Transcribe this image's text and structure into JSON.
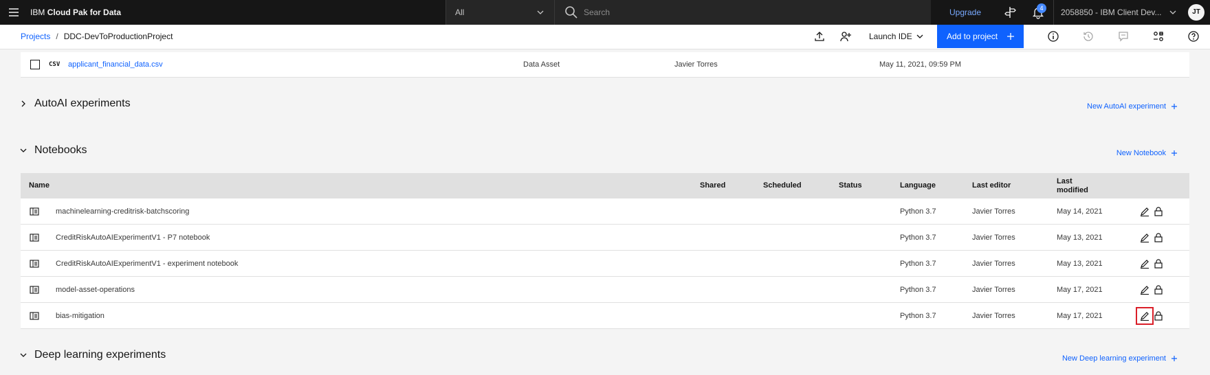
{
  "topnav": {
    "brand_prefix": "IBM",
    "brand_bold": "Cloud Pak for Data",
    "scope_value": "All",
    "search_placeholder": "Search",
    "upgrade_label": "Upgrade",
    "notification_count": "4",
    "account_name": "2058850 - IBM Client Dev...",
    "avatar_initials": "JT"
  },
  "subheader": {
    "breadcrumb_root": "Projects",
    "breadcrumb_separator": "/",
    "breadcrumb_current": "DDC-DevToProductionProject",
    "launch_ide_label": "Launch IDE",
    "add_to_project_label": "Add to project"
  },
  "data_asset": {
    "format": "CSV",
    "name": "applicant_financial_data.csv",
    "type": "Data Asset",
    "owner": "Javier Torres",
    "modified": "May 11, 2021, 09:59 PM"
  },
  "autoai": {
    "title": "AutoAI experiments",
    "new_label": "New AutoAI experiment"
  },
  "notebooks": {
    "title": "Notebooks",
    "new_label": "New Notebook",
    "columns": {
      "name": "Name",
      "shared": "Shared",
      "scheduled": "Scheduled",
      "status": "Status",
      "language": "Language",
      "last_editor": "Last editor",
      "last_modified_line1": "Last",
      "last_modified_line2": "modified"
    },
    "rows": [
      {
        "name": "machinelearning-creditrisk-batchscoring",
        "language": "Python 3.7",
        "editor": "Javier Torres",
        "modified": "May 14, 2021"
      },
      {
        "name": "CreditRiskAutoAIExperimentV1 - P7 notebook",
        "language": "Python 3.7",
        "editor": "Javier Torres",
        "modified": "May 13, 2021"
      },
      {
        "name": "CreditRiskAutoAIExperimentV1 - experiment notebook",
        "language": "Python 3.7",
        "editor": "Javier Torres",
        "modified": "May 13, 2021"
      },
      {
        "name": "model-asset-operations",
        "language": "Python 3.7",
        "editor": "Javier Torres",
        "modified": "May 17, 2021"
      },
      {
        "name": "bias-mitigation",
        "language": "Python 3.7",
        "editor": "Javier Torres",
        "modified": "May 17, 2021"
      }
    ]
  },
  "deep_learning": {
    "title": "Deep learning experiments",
    "new_label": "New Deep learning experiment"
  },
  "colors": {
    "primary": "#0f62fe",
    "nav_bg": "#161616",
    "highlight": "#da1e28"
  },
  "icons": {
    "menu": "hamburger-icon",
    "search": "search-icon",
    "notebook": "notebook-icon",
    "edit": "pencil-icon",
    "lock": "lock-icon"
  }
}
